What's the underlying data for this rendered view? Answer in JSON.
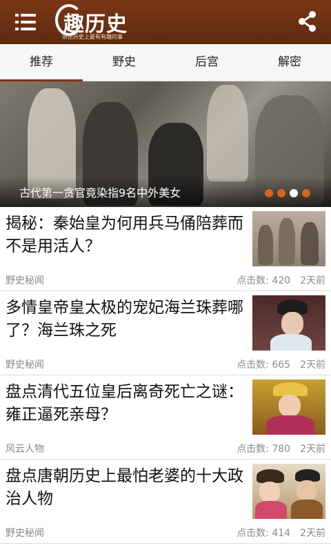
{
  "header": {
    "app_title": "趣历史",
    "slogan": "讲述历史上最有有趣的事"
  },
  "tabs": [
    {
      "label": "推荐"
    },
    {
      "label": "野史"
    },
    {
      "label": "后宫"
    },
    {
      "label": "解密"
    }
  ],
  "banner": {
    "caption": "古代第一贪官竟染指9名中外美女",
    "slide_count": 4,
    "active_slide": 3
  },
  "labels": {
    "clicks_prefix": "点击数:"
  },
  "news": [
    {
      "title": "揭秘：秦始皇为何用兵马俑陪葬而不是用活人？",
      "category": "野史秘闻",
      "clicks": "点击数: 420",
      "time": "2天前"
    },
    {
      "title": "多情皇帝皇太极的宠妃海兰珠葬哪了？海兰珠之死",
      "category": "野史秘闻",
      "clicks": "点击数: 665",
      "time": "2天前"
    },
    {
      "title": "盘点清代五位皇后离奇死亡之谜：雍正逼死亲母？",
      "category": "风云人物",
      "clicks": "点击数: 780",
      "time": "2天前"
    },
    {
      "title": "盘点唐朝历史上最怕老婆的十大政治人物",
      "category": "野史秘闻",
      "clicks": "点击数: 414",
      "time": "2天前"
    }
  ],
  "colors": {
    "header_bg": "#6b3014",
    "tab_indicator": "#7a3716",
    "banner_dot": "#d9631a",
    "banner_dot_active": "#ffffff"
  },
  "icons": {
    "menu": "menu-icon",
    "share": "share-icon"
  }
}
